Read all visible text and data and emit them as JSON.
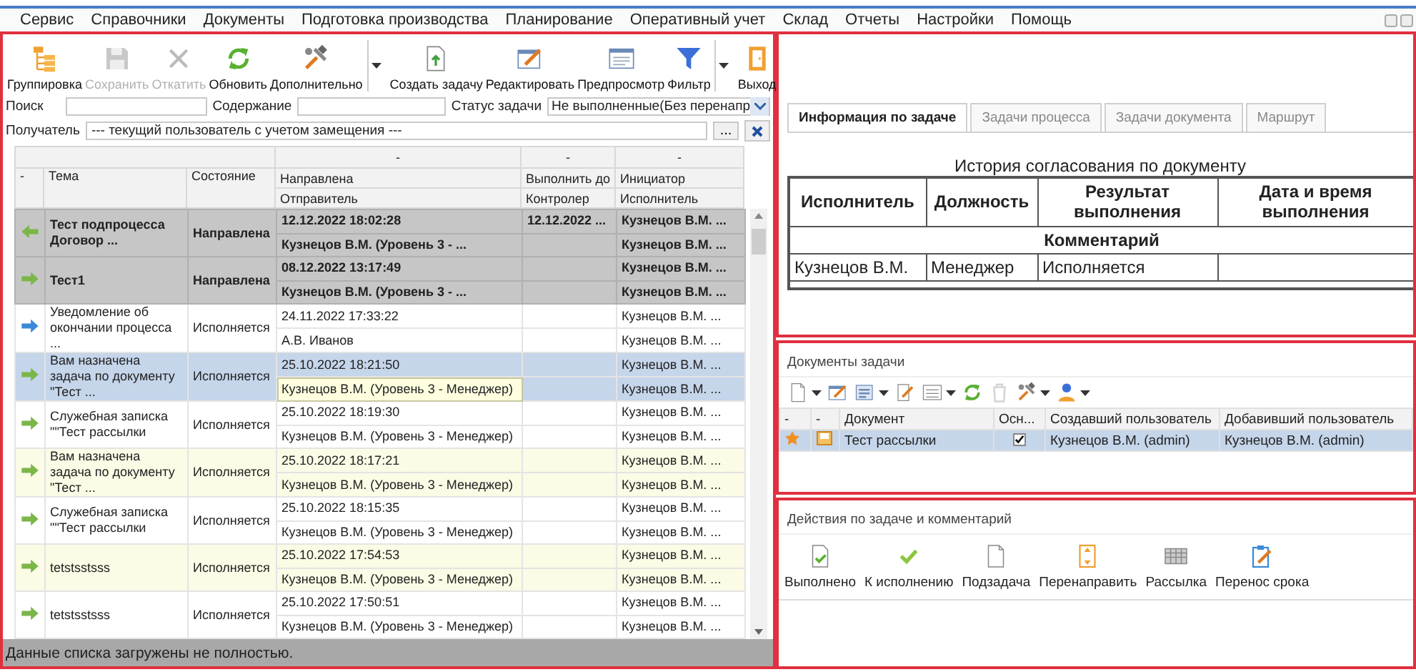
{
  "menu": [
    "Сервис",
    "Справочники",
    "Документы",
    "Подготовка производства",
    "Планирование",
    "Оперативный учет",
    "Склад",
    "Отчеты",
    "Настройки",
    "Помощь"
  ],
  "toolbar": [
    {
      "kind": "group",
      "label": "Группировка",
      "disabled": false,
      "dropdown": false
    },
    {
      "kind": "save",
      "label": "Сохранить",
      "disabled": true,
      "dropdown": false
    },
    {
      "kind": "revert",
      "label": "Откатить",
      "disabled": true,
      "dropdown": false
    },
    {
      "kind": "refresh",
      "label": "Обновить",
      "disabled": false,
      "dropdown": false
    },
    {
      "kind": "more",
      "label": "Дополнительно",
      "disabled": false,
      "dropdown": true
    },
    {
      "kind": "create",
      "label": "Создать задачу",
      "disabled": false,
      "dropdown": false
    },
    {
      "kind": "edit",
      "label": "Редактировать",
      "disabled": false,
      "dropdown": false
    },
    {
      "kind": "preview",
      "label": "Предпросмотр",
      "disabled": false,
      "dropdown": false
    },
    {
      "kind": "filter",
      "label": "Фильтр",
      "disabled": false,
      "dropdown": true
    },
    {
      "kind": "exit",
      "label": "Выход",
      "disabled": false,
      "dropdown": false
    }
  ],
  "filters": {
    "search": {
      "label": "Поиск"
    },
    "content": {
      "label": "Содержание"
    },
    "status": {
      "label": "Статус задачи",
      "value": "Не выполненные(Без перенапр"
    },
    "recipient": {
      "label": "Получатель",
      "value": "--- текущий пользователь с учетом замещения ---",
      "browse": "..."
    }
  },
  "tasks": {
    "band": [
      "-",
      "-",
      "-"
    ],
    "marker": "-",
    "theme": "Тема",
    "state": "Состояние",
    "pairs": [
      [
        "Направлена",
        "Отправитель"
      ],
      [
        "Выполнить до",
        "Контролер"
      ],
      [
        "Инициатор",
        "Исполнитель"
      ]
    ],
    "rows": [
      {
        "kind": "back",
        "bold": true,
        "selected": false,
        "theme": "Тест подпроцесса Договор ...",
        "state": "Направлена",
        "sent": "12.12.2022 18:02:28",
        "sender": "Кузнецов В.М. (Уровень 3 - ...",
        "due": "12.12.2022 ...",
        "initiator": "Кузнецов В.М. ...",
        "executor": "Кузнецов В.М. ..."
      },
      {
        "kind": "task",
        "bold": true,
        "selected": false,
        "theme": "Тест1",
        "state": "Направлена",
        "sent": "08.12.2022 13:17:49",
        "sender": "Кузнецов В.М. (Уровень 3 - ...",
        "initiator": "Кузнецов В.М. ...",
        "executor": "Кузнецов В.М. ..."
      },
      {
        "kind": "notice",
        "bold": false,
        "selected": false,
        "theme": "Уведомление об окончании процесса ...",
        "state": "Исполняется",
        "sent": "24.11.2022 17:33:22",
        "sender": "А.В. Иванов",
        "initiator": "Кузнецов В.М. ...",
        "executor": "Кузнецов В.М. ..."
      },
      {
        "kind": "task",
        "bold": false,
        "selected": true,
        "theme": "Вам назначена задача по документу \"Тест ...",
        "state": "Исполняется",
        "sent": "25.10.2022 18:21:50",
        "sender": "Кузнецов В.М. (Уровень 3 - Менеджер)",
        "initiator": "Кузнецов В.М. ...",
        "executor": "Кузнецов В.М. ..."
      },
      {
        "kind": "task",
        "bold": false,
        "selected": false,
        "theme": "Служебная записка \"\"Тест рассылки",
        "state": "Исполняется",
        "sent": "25.10.2022 18:19:30",
        "sender": "Кузнецов В.М. (Уровень 3 - Менеджер)",
        "initiator": "Кузнецов В.М. ...",
        "executor": "Кузнецов В.М. ..."
      },
      {
        "kind": "task",
        "bold": false,
        "selected": false,
        "theme": "Вам назначена задача по документу \"Тест ...",
        "state": "Исполняется",
        "sent": "25.10.2022 18:17:21",
        "sender": "Кузнецов В.М. (Уровень 3 - Менеджер)",
        "initiator": "Кузнецов В.М. ...",
        "executor": "Кузнецов В.М. ..."
      },
      {
        "kind": "task",
        "bold": false,
        "selected": false,
        "theme": "Служебная записка \"\"Тест рассылки",
        "state": "Исполняется",
        "sent": "25.10.2022 18:15:35",
        "sender": "Кузнецов В.М. (Уровень 3 - Менеджер)",
        "initiator": "Кузнецов В.М. ...",
        "executor": "Кузнецов В.М. ..."
      },
      {
        "kind": "task",
        "bold": false,
        "selected": false,
        "theme": "tetstsstsss",
        "state": "Исполняется",
        "sent": "25.10.2022 17:54:53",
        "sender": "Кузнецов В.М. (Уровень 3 - Менеджер)",
        "initiator": "Кузнецов В.М. ...",
        "executor": "Кузнецов В.М. ..."
      },
      {
        "kind": "task",
        "bold": false,
        "selected": false,
        "theme": "tetstsstsss",
        "state": "Исполняется",
        "sent": "25.10.2022 17:50:51",
        "sender": "Кузнецов В.М. (Уровень 3 - Менеджер)",
        "initiator": "Кузнецов В.М. ...",
        "executor": "Кузнецов В.М. ..."
      }
    ]
  },
  "status_bar": "Данные списка загружены не полностью.",
  "tabs": [
    {
      "label": "Информация по задаче",
      "selected": true
    },
    {
      "label": "Задачи процесса",
      "selected": false
    },
    {
      "label": "Задачи документа",
      "selected": false
    },
    {
      "label": "Маршрут",
      "selected": false
    }
  ],
  "history": {
    "title": "История согласования по документу",
    "columns": [
      "Исполнитель",
      "Должность",
      "Результат выполнения",
      "Дата и время выполнения"
    ],
    "comment_header": "Комментарий",
    "rows": [
      {
        "executor": "Кузнецов В.М.",
        "position": "Менеджер",
        "result": "Исполняется"
      }
    ]
  },
  "documents": {
    "title": "Документы задачи",
    "toolbar": [
      {
        "kind": "new",
        "dropdown": true,
        "disabled": false
      },
      {
        "kind": "edit",
        "dropdown": false,
        "disabled": false
      },
      {
        "kind": "card",
        "dropdown": true,
        "disabled": false
      },
      {
        "kind": "edit2",
        "dropdown": false,
        "disabled": false
      },
      {
        "kind": "list",
        "dropdown": true,
        "disabled": false
      },
      {
        "kind": "refresh",
        "dropdown": false,
        "disabled": false
      },
      {
        "kind": "delete",
        "dropdown": false,
        "disabled": true
      },
      {
        "kind": "more",
        "dropdown": true,
        "disabled": false
      },
      {
        "kind": "user",
        "dropdown": true,
        "disabled": false
      }
    ],
    "columns": [
      "-",
      "-",
      "Документ",
      "Осн...",
      "Создавший пользователь",
      "Добавивший пользователь"
    ],
    "rows": [
      {
        "favorite": true,
        "selected": true,
        "name": "Тест рассылки",
        "main": true,
        "creator": "Кузнецов В.М. (admin)",
        "adder": "Кузнецов В.М. (admin)"
      }
    ]
  },
  "actions": {
    "title": "Действия по задаче и комментарий",
    "buttons": [
      {
        "kind": "done",
        "label": "Выполнено"
      },
      {
        "kind": "accept",
        "label": "К исполнению"
      },
      {
        "kind": "subtask",
        "label": "Подзадача"
      },
      {
        "kind": "redirect",
        "label": "Перенаправить"
      },
      {
        "kind": "mailing",
        "label": "Рассылка"
      },
      {
        "kind": "postpone",
        "label": "Перенос срока"
      }
    ]
  }
}
